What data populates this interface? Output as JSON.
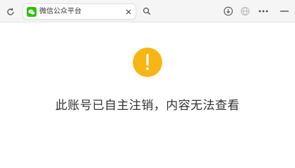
{
  "browser": {
    "tab": {
      "title": "微信公众平台",
      "favicon": "wechat-icon",
      "favicon_color": "#2dc100"
    },
    "icons": {
      "refresh": "refresh-icon",
      "close": "close-icon",
      "search": "search-icon",
      "download": "download-icon",
      "globe": "globe-icon",
      "more": "more-icon",
      "minimize": "minimize-icon"
    }
  },
  "page": {
    "icon": "warning-icon",
    "icon_color": "#f8b614",
    "icon_symbol": "!",
    "message": "此账号已自主注销，内容无法查看"
  }
}
